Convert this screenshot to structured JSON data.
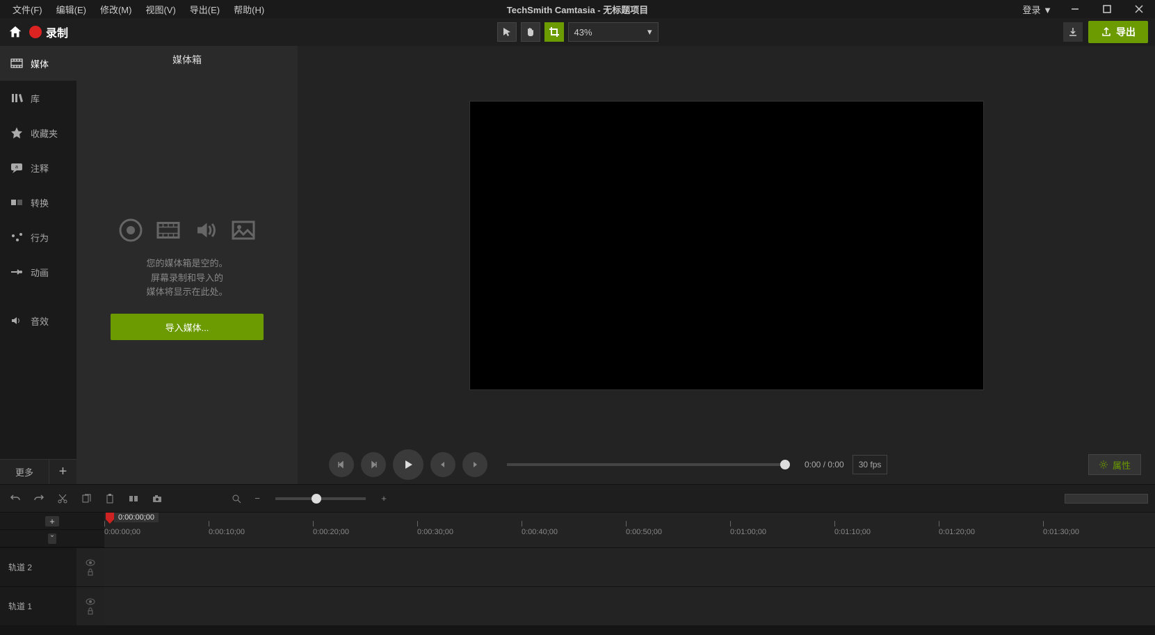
{
  "menubar": {
    "items": [
      "文件(F)",
      "编辑(E)",
      "修改(M)",
      "视图(V)",
      "导出(E)",
      "帮助(H)"
    ],
    "title": "TechSmith Camtasia - 无标题项目",
    "login": "登录 ▼"
  },
  "topbar": {
    "record": "录制",
    "zoom": "43%",
    "export": "导出"
  },
  "sidebar": {
    "tabs": [
      {
        "label": "媒体",
        "icon": "film"
      },
      {
        "label": "库",
        "icon": "books"
      },
      {
        "label": "收藏夹",
        "icon": "star"
      },
      {
        "label": "注释",
        "icon": "callout"
      },
      {
        "label": "转换",
        "icon": "transition"
      },
      {
        "label": "行为",
        "icon": "behavior"
      },
      {
        "label": "动画",
        "icon": "animation"
      },
      {
        "label": "音效",
        "icon": "audio"
      }
    ],
    "more": "更多"
  },
  "bin": {
    "title": "媒体箱",
    "empty_line1": "您的媒体箱是空的。",
    "empty_line2": "屏幕录制和导入的",
    "empty_line3": "媒体将显示在此处。",
    "import": "导入媒体..."
  },
  "playbar": {
    "time": "0:00 / 0:00",
    "fps": "30 fps",
    "properties": "属性"
  },
  "timeline": {
    "playhead_time": "0:00:00;00",
    "ticks": [
      "0:00:00;00",
      "0:00:10;00",
      "0:00:20;00",
      "0:00:30;00",
      "0:00:40;00",
      "0:00:50;00",
      "0:01:00;00",
      "0:01:10;00",
      "0:01:20;00",
      "0:01:30;00"
    ],
    "tracks": [
      {
        "label": "轨道 2"
      },
      {
        "label": "轨道 1"
      }
    ]
  }
}
